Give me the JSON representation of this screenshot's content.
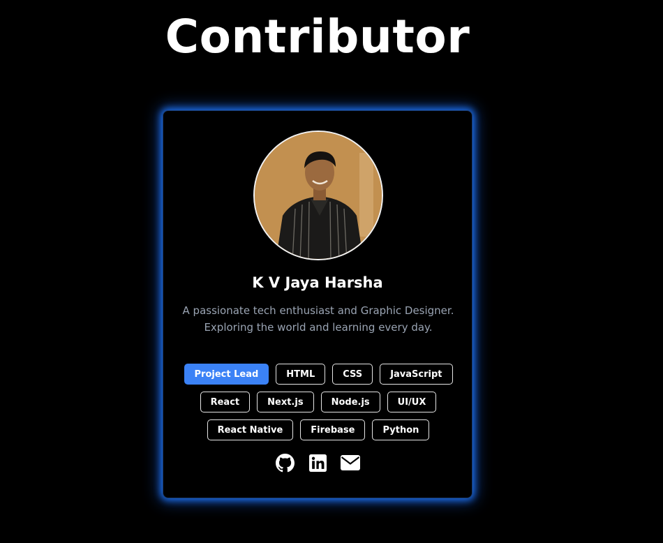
{
  "page": {
    "title": "Contributor"
  },
  "contributor": {
    "name": "K V Jaya Harsha",
    "bio": "A passionate tech enthusiast and Graphic Designer. Exploring the world and learning every day.",
    "tags": [
      {
        "label": "Project Lead",
        "highlight": true
      },
      {
        "label": "HTML"
      },
      {
        "label": "CSS"
      },
      {
        "label": "JavaScript"
      },
      {
        "label": "React"
      },
      {
        "label": "Next.js"
      },
      {
        "label": "Node.js"
      },
      {
        "label": "UI/UX"
      },
      {
        "label": "React Native"
      },
      {
        "label": "Firebase"
      },
      {
        "label": "Python"
      }
    ],
    "socials": [
      {
        "icon": "github-icon"
      },
      {
        "icon": "linkedin-icon"
      },
      {
        "icon": "email-icon"
      }
    ]
  },
  "colors": {
    "background": "#000000",
    "accent": "#3b82f6",
    "glow": "#1e78ff",
    "bio_text": "#9aa4b3"
  }
}
